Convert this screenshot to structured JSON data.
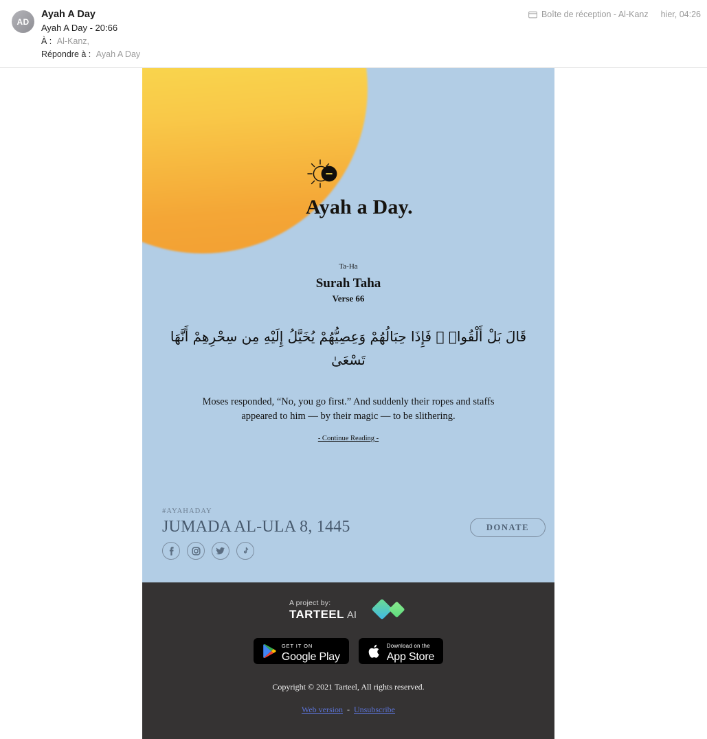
{
  "mail_header": {
    "avatar_initials": "AD",
    "sender_name": "Ayah A Day",
    "subject": "Ayah A Day - 20:66",
    "to_label": "À :",
    "to_value": "Al-Kanz,",
    "reply_to_label": "Répondre à :",
    "reply_to_value": "Ayah A Day",
    "folder_icon": "inbox-folder-icon",
    "folder": "Boîte de réception - Al-Kanz",
    "time": "hier, 04:26"
  },
  "hero": {
    "logo_icon": "sun-eclipse-icon",
    "brand": "Ayah a Day.",
    "surah_sub": "Ta-Ha",
    "surah_name": "Surah Taha",
    "verse_no": "Verse 66",
    "arabic": "قَالَ بَلْ أَلْقُوا۟ ۖ فَإِذَا حِبَالُهُمْ وَعِصِيُّهُمْ يُخَيَّلُ إِلَيْهِ مِن سِحْرِهِمْ أَنَّهَا تَسْعَىٰ",
    "translation": "Moses responded, “No, you go first.” And suddenly their ropes and staffs appeared to him — by their magic — to be slithering.",
    "continue_reading": "- Continue Reading -",
    "hashtag": "#AYAHADAY",
    "hijri_date": "JUMADA AL-ULA 8, 1445",
    "donate_label": "DONATE",
    "socials": [
      {
        "name": "facebook-icon"
      },
      {
        "name": "instagram-icon"
      },
      {
        "name": "twitter-icon"
      },
      {
        "name": "tiktok-icon"
      }
    ],
    "colors": {
      "background": "#b2cde5",
      "sun_top": "#fbe74e",
      "sun_bottom": "#f2a033",
      "accent_text": "#47596d"
    }
  },
  "footer": {
    "project_label": "A project by:",
    "brand_bold": "TARTEEL",
    "brand_light": "AI",
    "logo_icon": "tarteel-diamonds-icon",
    "google_play": {
      "icon": "google-play-icon",
      "small": "GET IT ON",
      "big": "Google Play"
    },
    "app_store": {
      "icon": "apple-icon",
      "small": "Download on the",
      "big": "App Store"
    },
    "copyright": "Copyright © 2021 Tarteel, All rights reserved.",
    "web_version": "Web version",
    "separator": "-",
    "unsubscribe": "Unsubscribe",
    "colors": {
      "background": "#353333",
      "link": "#5b73d6",
      "logo_start": "#4ec3e0",
      "logo_end": "#6ee07a"
    }
  }
}
